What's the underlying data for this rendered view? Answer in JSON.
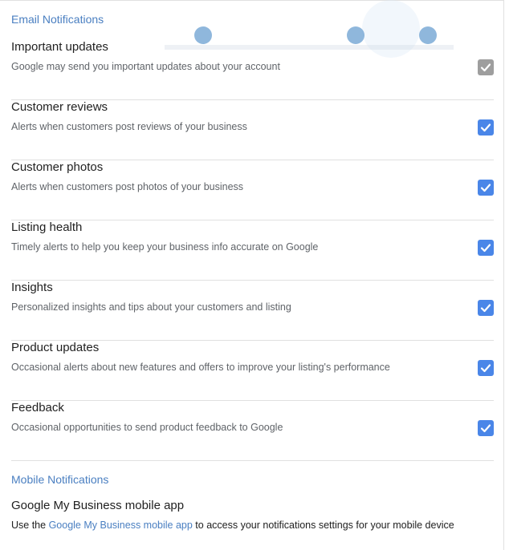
{
  "email_section": {
    "title": "Email Notifications",
    "items": [
      {
        "title": "Important updates",
        "description": "Google may send you important updates about your account",
        "checked": true,
        "disabled": true
      },
      {
        "title": "Customer reviews",
        "description": "Alerts when customers post reviews of your business",
        "checked": true,
        "disabled": false
      },
      {
        "title": "Customer photos",
        "description": "Alerts when customers post photos of your business",
        "checked": true,
        "disabled": false
      },
      {
        "title": "Listing health",
        "description": "Timely alerts to help you keep your business info accurate on Google",
        "checked": true,
        "disabled": false
      },
      {
        "title": "Insights",
        "description": "Personalized insights and tips about your customers and listing",
        "checked": true,
        "disabled": false
      },
      {
        "title": "Product updates",
        "description": "Occasional alerts about new features and offers to improve your listing's performance",
        "checked": true,
        "disabled": false
      },
      {
        "title": "Feedback",
        "description": "Occasional opportunities to send product feedback to Google",
        "checked": true,
        "disabled": false
      }
    ]
  },
  "mobile_section": {
    "title": "Mobile Notifications",
    "app_title": "Google My Business mobile app",
    "desc_prefix": "Use the ",
    "desc_link": "Google My Business mobile app",
    "desc_suffix": " to access your notifications settings for your mobile device"
  },
  "colors": {
    "accent": "#4a86e8",
    "link": "#4a7fc1",
    "disabled_checkbox": "#9e9e9e"
  }
}
